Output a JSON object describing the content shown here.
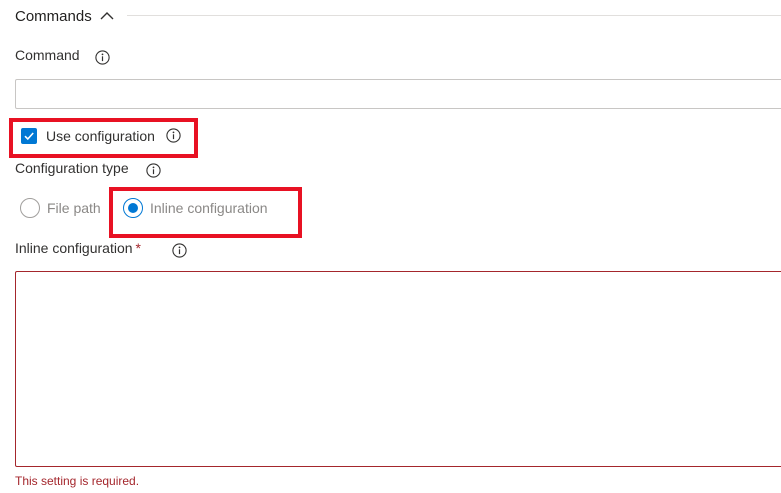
{
  "section": {
    "title": "Commands",
    "expanded": true,
    "collapse_icon": "chevron-up-icon"
  },
  "command": {
    "label": "Command",
    "info_icon": "info-icon",
    "value": "",
    "placeholder": ""
  },
  "use_configuration": {
    "label": "Use configuration",
    "checked": true,
    "info_icon": "info-icon"
  },
  "configuration_type": {
    "label": "Configuration type",
    "info_icon": "info-icon",
    "options": [
      {
        "label": "File path",
        "selected": false
      },
      {
        "label": "Inline configuration",
        "selected": true
      }
    ]
  },
  "inline_configuration": {
    "label": "Inline configuration",
    "required_marker": "*",
    "info_icon": "info-icon",
    "value": "",
    "error": "This setting is required."
  },
  "colors": {
    "accent": "#0078d4",
    "error": "#a4262c",
    "highlight": "#e81123",
    "disabled_text": "#8a8886"
  }
}
